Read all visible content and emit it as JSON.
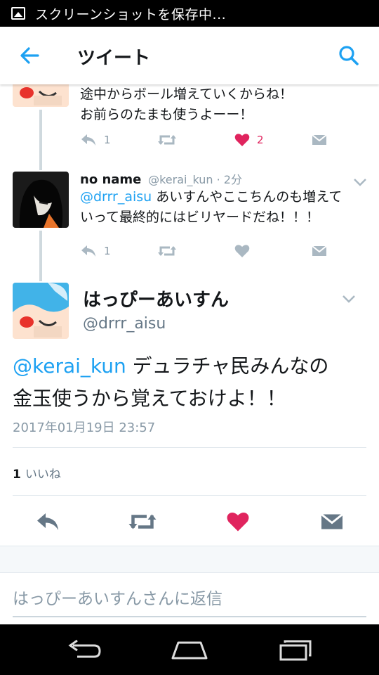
{
  "status_bar": {
    "text": "スクリーンショットを保存中..."
  },
  "app_bar": {
    "title": "ツイート",
    "back_icon": "back-arrow-icon",
    "search_icon": "search-icon"
  },
  "colors": {
    "accent": "#1da1f2",
    "like": "#e0245e",
    "muted": "#8899a6",
    "icon": "#aab8c2"
  },
  "thread": [
    {
      "text_lines": [
        "途中からボール増えていくからね！",
        "お前らのたまも使うよーー！"
      ],
      "reply_count": "1",
      "retweet_count": "",
      "like_count": "2",
      "liked": true
    },
    {
      "name": "no name",
      "handle": "@kerai_kun · 2分",
      "mention": "@drrr_aisu",
      "text_after_mention": " あいすんやここちんのも増えて",
      "text_line2": "いって最終的にはビリヤードだね！！！",
      "reply_count": "1",
      "like_count": "",
      "liked": false
    }
  ],
  "main_tweet": {
    "name": "はっぴーあいすん",
    "handle": "@drrr_aisu",
    "mention": "@kerai_kun",
    "text_line1_rest": " デュラチャ民みんなの",
    "text_line2": "金玉使うから覚えておけよ！！",
    "date": "2017年01月19日 23:57",
    "likes_count": "1",
    "likes_label": "いいね"
  },
  "reply_placeholder": "はっぴーあいすんさんに返信"
}
